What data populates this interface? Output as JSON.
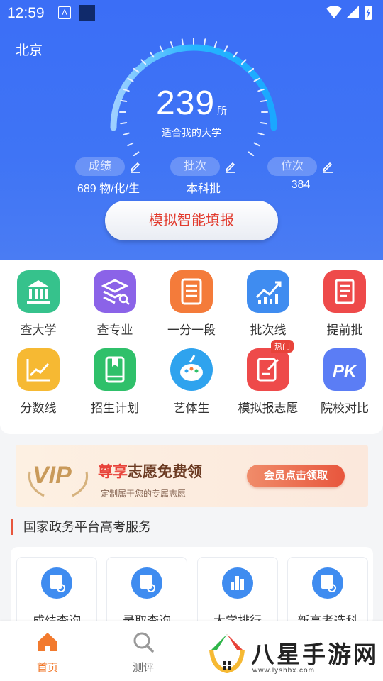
{
  "status_bar": {
    "time": "12:59",
    "notif_glyph": "A"
  },
  "location": {
    "city": "北京"
  },
  "gauge": {
    "count": "239",
    "unit": "所",
    "caption": "适合我的大学"
  },
  "params": [
    {
      "label": "成绩",
      "value": "689 物/化/生"
    },
    {
      "label": "批次",
      "value": "本科批"
    },
    {
      "label": "位次",
      "value": "384"
    }
  ],
  "simulate_button": "模拟智能填报",
  "features": [
    {
      "label": "查大学",
      "icon": "university-icon",
      "color": "#36c28c"
    },
    {
      "label": "查专业",
      "icon": "layers-search-icon",
      "color": "#8b63e8"
    },
    {
      "label": "一分一段",
      "icon": "list-doc-icon",
      "color": "#f47b3a"
    },
    {
      "label": "批次线",
      "icon": "trend-chart-icon",
      "color": "#3f8cf0"
    },
    {
      "label": "提前批",
      "icon": "scroll-icon",
      "color": "#ee4a4a"
    },
    {
      "label": "分数线",
      "icon": "line-chart-icon",
      "color": "#f6b933"
    },
    {
      "label": "招生计划",
      "icon": "book-icon",
      "color": "#2fc06a"
    },
    {
      "label": "艺体生",
      "icon": "palette-icon",
      "color": "#2fa3ee"
    },
    {
      "label": "模拟报志愿",
      "icon": "edit-form-icon",
      "color": "#ee4a4a",
      "badge": "热门"
    },
    {
      "label": "院校对比",
      "icon": "pk-icon",
      "color": "#5b7df5"
    }
  ],
  "vip_banner": {
    "logo_text": "VIP",
    "title_highlight": "尊享",
    "title_rest": "志愿免费领",
    "subtitle": "定制属于您的专属志愿",
    "button": "会员点击领取"
  },
  "section_title": "国家政务平台高考服务",
  "services": [
    {
      "label": "成绩查询",
      "icon": "score-query-icon"
    },
    {
      "label": "录取查询",
      "icon": "admission-query-icon"
    },
    {
      "label": "大学排行",
      "icon": "ranking-icon"
    },
    {
      "label": "新高考选科",
      "icon": "subject-select-icon"
    }
  ],
  "tabs": [
    {
      "label": "首页",
      "active": true
    },
    {
      "label": "测评",
      "active": false
    }
  ],
  "watermark": {
    "text": "八星手游网",
    "url": "www.lyshbx.com"
  },
  "colors": {
    "primary": "#3b6ef6",
    "accent_red": "#e8433a",
    "tab_active": "#f27a2e"
  }
}
